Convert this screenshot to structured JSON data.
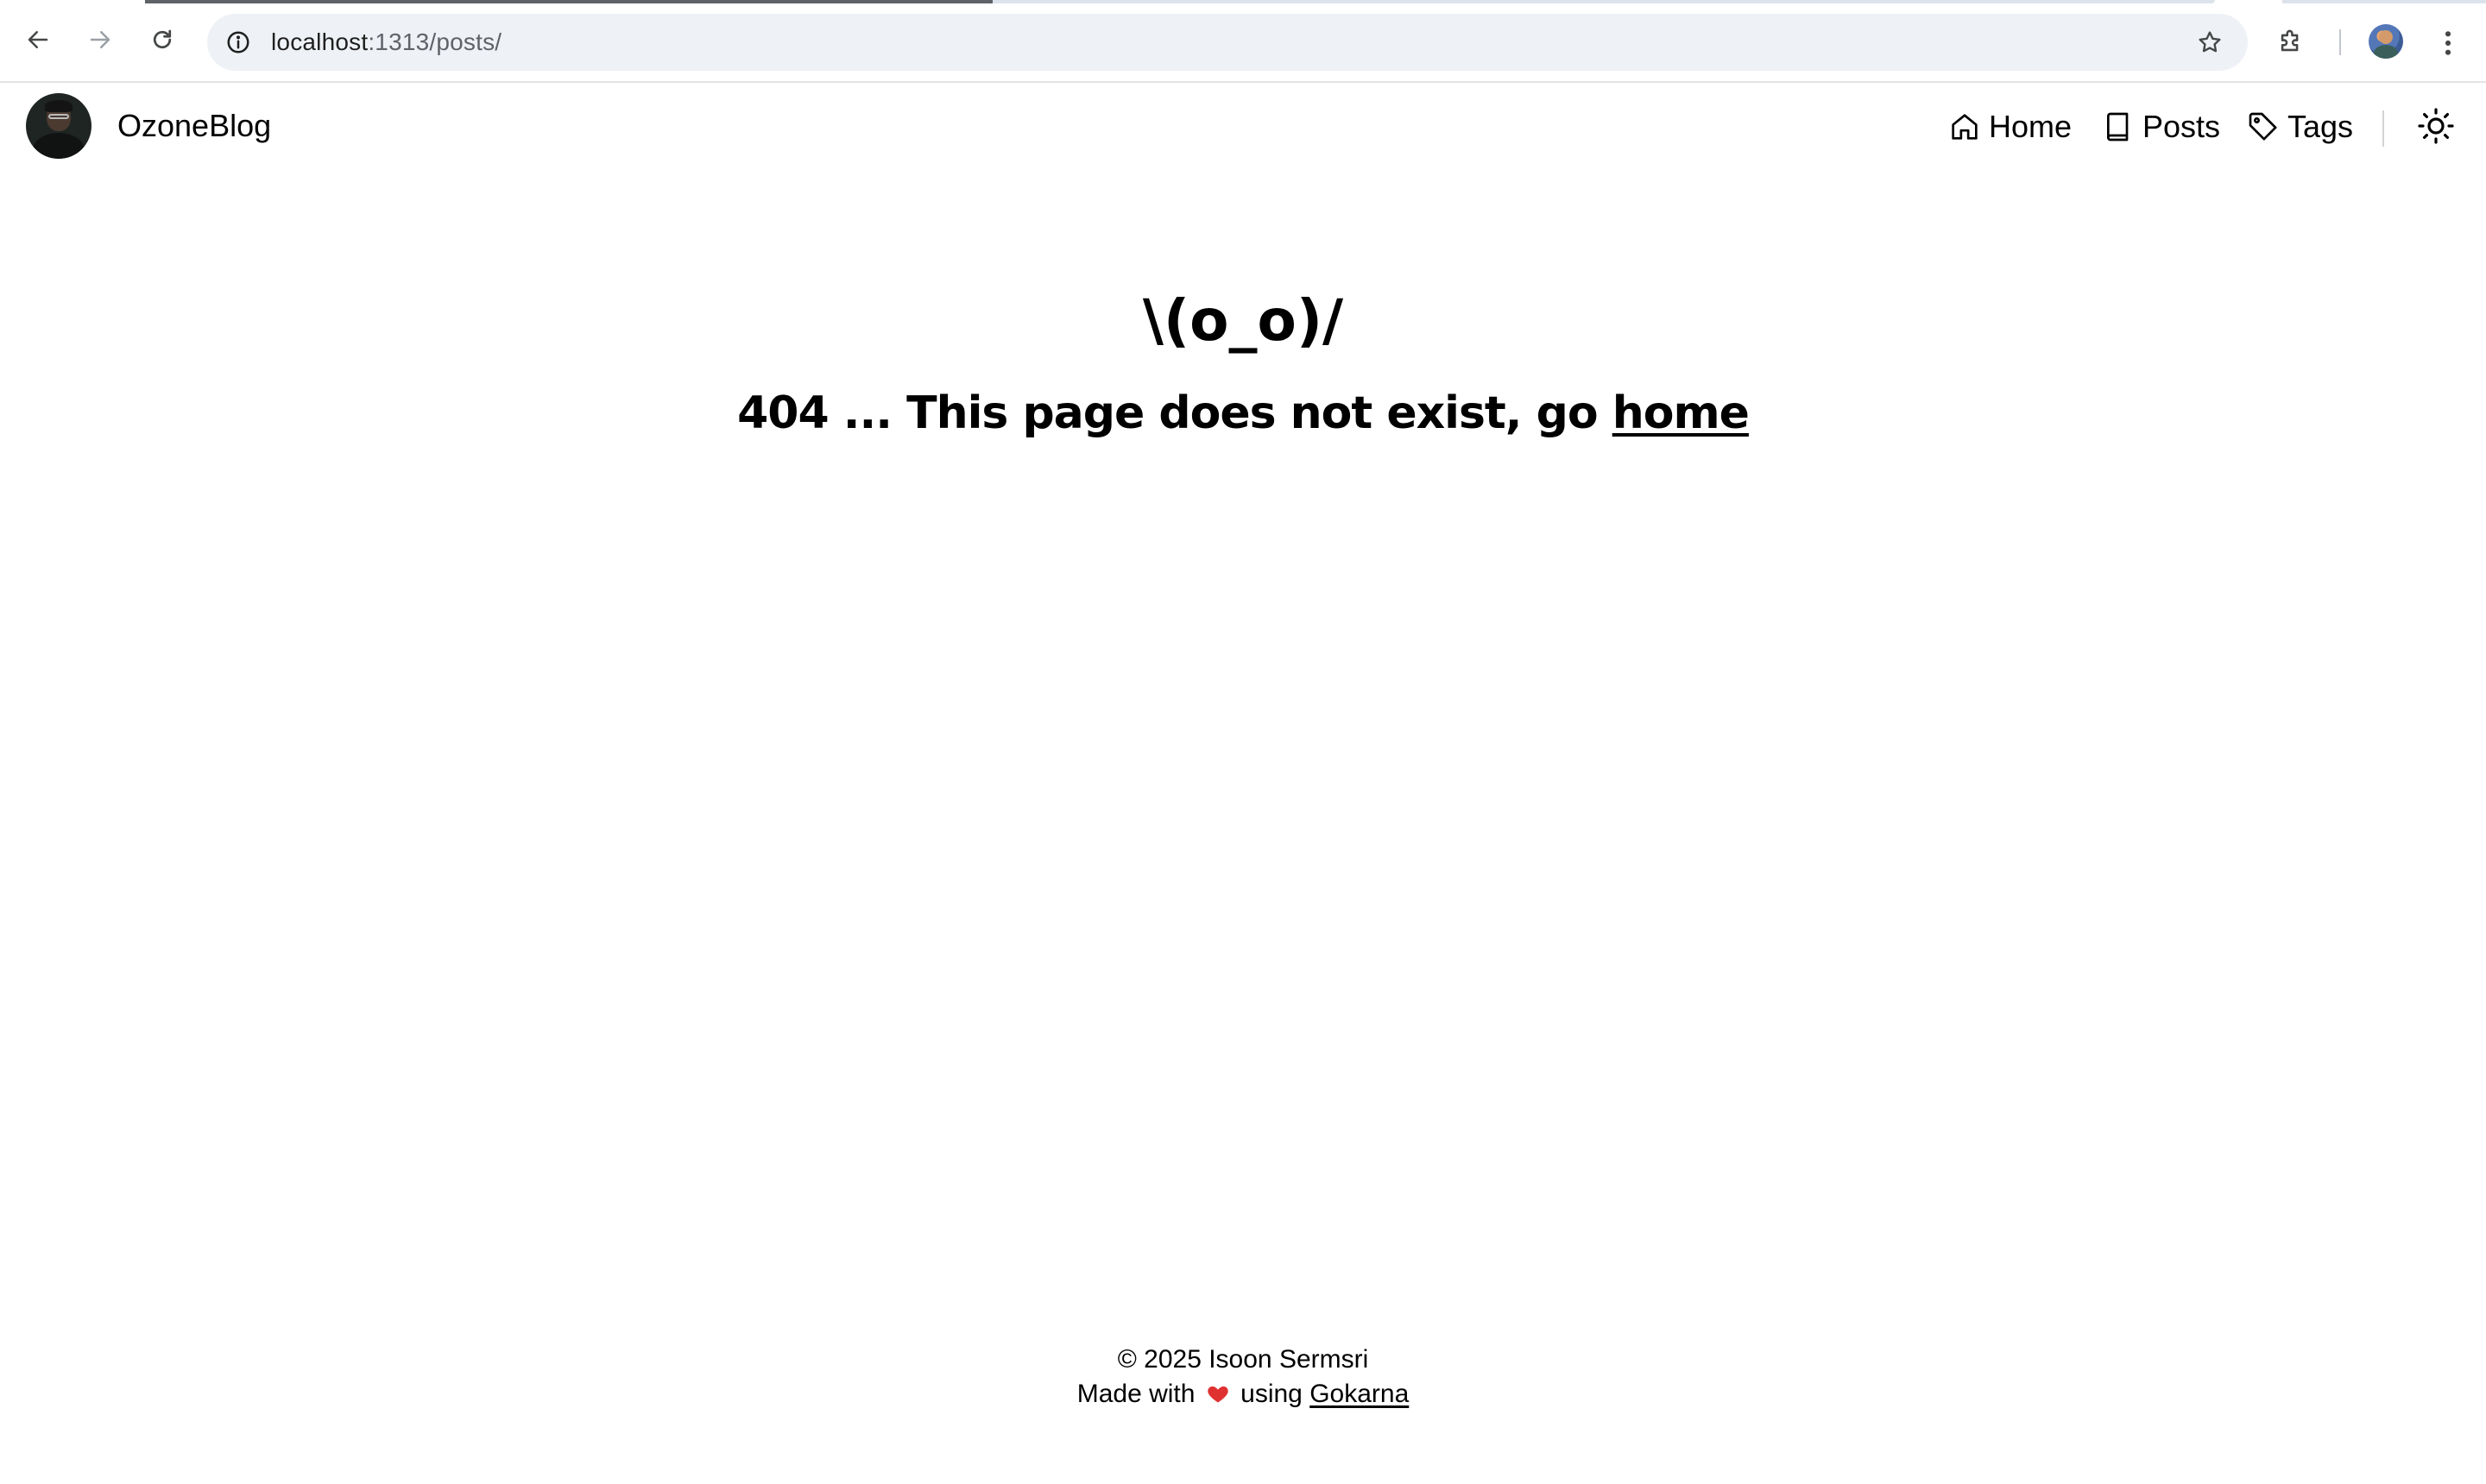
{
  "browser": {
    "url_host": "localhost",
    "url_rest": ":1313/posts/",
    "icons": {
      "back": "arrow-left-icon",
      "forward": "arrow-right-icon",
      "reload": "reload-icon",
      "site_info": "info-circle-icon",
      "bookmark": "star-icon",
      "extensions": "puzzle-icon",
      "profile": "profile-avatar",
      "menu": "kebab-menu-icon"
    }
  },
  "header": {
    "site_title": "OzoneBlog",
    "nav": [
      {
        "label": "Home",
        "icon": "home-icon"
      },
      {
        "label": "Posts",
        "icon": "book-icon"
      },
      {
        "label": "Tags",
        "icon": "tag-icon"
      }
    ],
    "theme_toggle_icon": "sun-icon"
  },
  "main": {
    "kaomoji": "\\(o_o)/",
    "message_prefix": "404 ... This page does not exist, go ",
    "home_link": "home"
  },
  "footer": {
    "copyright": "© 2025 Isoon Sermsri",
    "made_with": "Made with",
    "using": "using",
    "theme_link": "Gokarna",
    "heart_color": "#e03131"
  },
  "colors": {
    "text": "#000000",
    "background": "#ffffff",
    "omnibox": "#eef1f6"
  }
}
